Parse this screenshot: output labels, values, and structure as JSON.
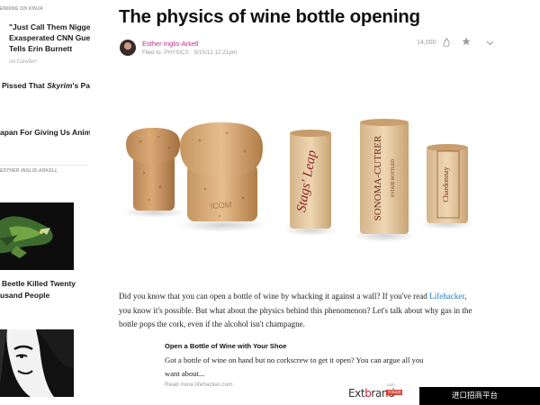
{
  "rail": {
    "trending_label": "ENDING ON KINJA",
    "items": [
      {
        "line1": "\"Just Call Them Niggers,\"",
        "line2": "Exasperated CNN Guest",
        "line3": "Tells Erin Burnett",
        "source": "on Gawker"
      },
      {
        "text_pre": "Pissed That ",
        "text_em": "Skyrim",
        "text_post": "'s Paid"
      },
      {
        "text": "apan For Giving Us Anime"
      }
    ],
    "more_from_label": "ESTHER INGLIS-ARKELL",
    "story_items": [
      {
        "line1": "Beetle Killed Twenty",
        "line2": "usand People"
      }
    ]
  },
  "article": {
    "title": "The physics of wine bottle opening",
    "author": "Esther Inglis-Arkell",
    "filed_to_label": "Filed to: PHYSICS",
    "date": "5/15/12 12:21pm",
    "views": "14,000",
    "body": {
      "p1_a": "Did you know that you can open a bottle of wine by whacking it against a wall? If you've read ",
      "p1_link": "Lifehacker",
      "p1_b": ", you know it's possible. But what about the physics behind this phenomenon? Let's talk about why gas in the bottle pops the cork, even if the alcohol isn't champagne."
    },
    "embed": {
      "title": "Open a Bottle of Wine with Your Shoe",
      "description": "Got a bottle of wine on hand but no corkscrew to get it open? You can argue all you want about...",
      "read_more": "Read more lifehacker.com"
    },
    "cork_labels": {
      "cork3": "Stags' Leap",
      "cork4": "SONOMA-CUTRER",
      "cork4_sub": "ESTATE BOTTLED",
      "cork5": "Chardonnay"
    }
  },
  "icons": {
    "views": "flame-icon",
    "like": "star-icon",
    "menu": "chevron-down-icon"
  },
  "footer": {
    "logo_pre": "Ext",
    "logo_b": "b",
    "logo_post": "rand",
    "logo_com": ".com",
    "logo_tag": "外贸动态",
    "badge": "进口招商平台"
  }
}
